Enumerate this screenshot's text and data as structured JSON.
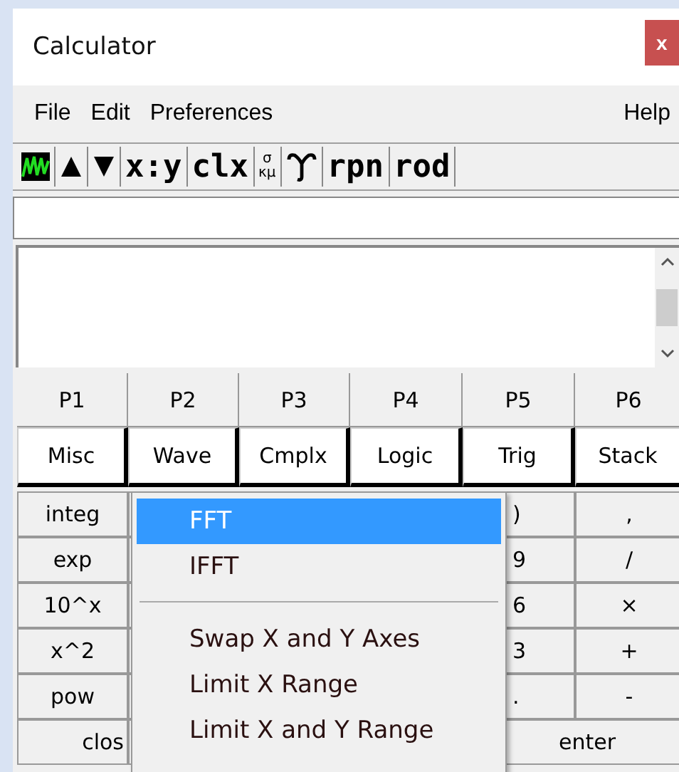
{
  "window": {
    "title": "Calculator",
    "close": "x"
  },
  "menu_bar": {
    "left": [
      "File",
      "Edit",
      "Preferences"
    ],
    "right": [
      "Help"
    ]
  },
  "toolbar": [
    {
      "kind": "wave"
    },
    {
      "kind": "up"
    },
    {
      "kind": "down"
    },
    {
      "kind": "text",
      "label": "x:y"
    },
    {
      "kind": "text",
      "label": "clx"
    },
    {
      "kind": "stacked",
      "top": "σ",
      "bottom": "κμ"
    },
    {
      "kind": "curl"
    },
    {
      "kind": "text",
      "label": "rpn"
    },
    {
      "kind": "text",
      "label": "rod"
    }
  ],
  "pages": [
    "P1",
    "P2",
    "P3",
    "P4",
    "P5",
    "P6"
  ],
  "groups": [
    "Misc",
    "Wave",
    "Cmplx",
    "Logic",
    "Trig",
    "Stack"
  ],
  "keypad": [
    {
      "column_1": "integ",
      "column_5": ")",
      "column_6": ","
    },
    {
      "column_1": "exp",
      "column_5": "9",
      "column_6": "/"
    },
    {
      "column_1": "10^x",
      "column_5": "6",
      "column_6": "×"
    },
    {
      "column_1": "x^2",
      "column_5": "3",
      "column_6": "+"
    },
    {
      "column_1": "pow",
      "column_5": ".",
      "column_6": "-"
    }
  ],
  "bottom_keys": [
    "clos",
    "enter"
  ],
  "popup_menu": [
    {
      "kind": "item",
      "label": "FFT",
      "selected": true
    },
    {
      "kind": "item",
      "label": "IFFT",
      "selected": false
    },
    {
      "kind": "separator"
    },
    {
      "kind": "item",
      "label": "Swap X and Y Axes",
      "selected": false
    },
    {
      "kind": "item",
      "label": "Limit X Range",
      "selected": false
    },
    {
      "kind": "item",
      "label": "Limit X and Y Range",
      "selected": false
    }
  ]
}
